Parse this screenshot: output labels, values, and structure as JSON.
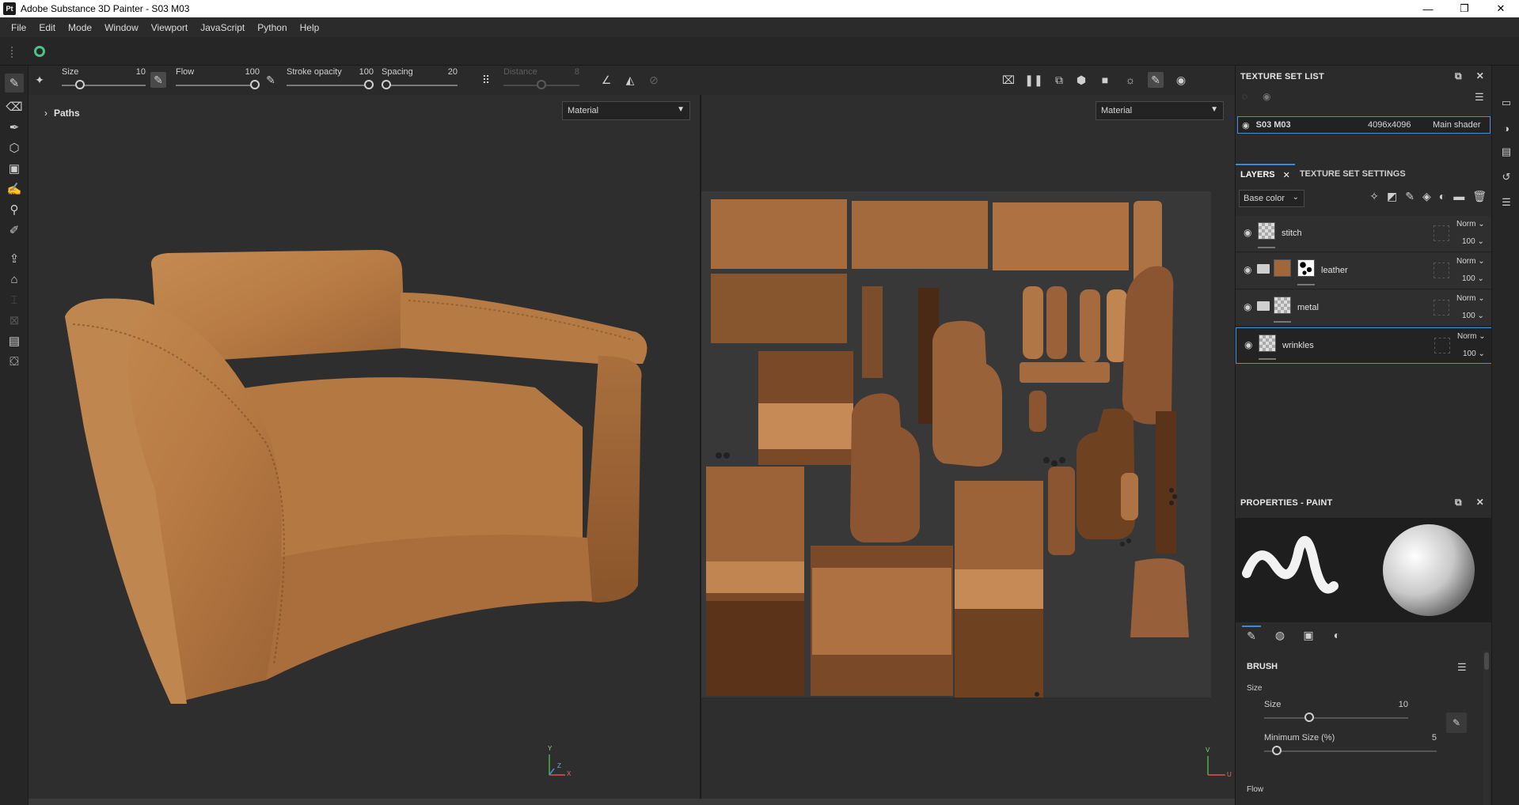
{
  "window": {
    "app_badge": "Pt",
    "title": "Adobe Substance 3D Painter - S03 M03",
    "controls": [
      "—",
      "❐",
      "✕"
    ]
  },
  "menu": [
    "File",
    "Edit",
    "Mode",
    "Window",
    "Viewport",
    "JavaScript",
    "Python",
    "Help"
  ],
  "tool_options": {
    "size": {
      "label": "Size",
      "value": "10",
      "fraction": 0.18
    },
    "flow": {
      "label": "Flow",
      "value": "100",
      "fraction": 1.0
    },
    "stroke_opacity": {
      "label": "Stroke opacity",
      "value": "100",
      "fraction": 1.0
    },
    "spacing": {
      "label": "Spacing",
      "value": "20",
      "fraction": 0.0
    },
    "distance": {
      "label": "Distance",
      "value": "8",
      "fraction": 0.5
    }
  },
  "viewport3d": {
    "paths_label": "Paths",
    "material_select": "Material",
    "gizmo_y": "Y",
    "gizmo_x": "X",
    "gizmo_z": "Z"
  },
  "viewport2d": {
    "material_select": "Material",
    "gizmo_v": "V",
    "gizmo_u": "U"
  },
  "texture_set_list": {
    "title": "TEXTURE SET LIST",
    "row": {
      "name": "S03 M03",
      "resolution": "4096x4096",
      "shader": "Main shader"
    }
  },
  "layers_panel": {
    "tabs": [
      "LAYERS",
      "TEXTURE SET SETTINGS"
    ],
    "channel": "Base color",
    "layers": [
      {
        "name": "stitch",
        "blend": "Norm",
        "opacity": "100",
        "folder": false,
        "selected": false
      },
      {
        "name": "leather",
        "blend": "Norm",
        "opacity": "100",
        "folder": true,
        "selected": false
      },
      {
        "name": "metal",
        "blend": "Norm",
        "opacity": "100",
        "folder": true,
        "selected": false
      },
      {
        "name": "wrinkles",
        "blend": "Norm",
        "opacity": "100",
        "folder": false,
        "selected": true
      }
    ]
  },
  "properties": {
    "title": "PROPERTIES - PAINT",
    "section": "BRUSH",
    "size_group": "Size",
    "size": {
      "label": "Size",
      "value": "10",
      "fraction": 0.3
    },
    "min_size": {
      "label": "Minimum Size (%)",
      "value": "5",
      "fraction": 0.05
    },
    "flow_group": "Flow"
  },
  "colors": {
    "accent": "#3b8ad9",
    "leather": "#b57a45",
    "panel_bg": "#2b2b2b",
    "viewport_bg": "#2e2e2e"
  }
}
